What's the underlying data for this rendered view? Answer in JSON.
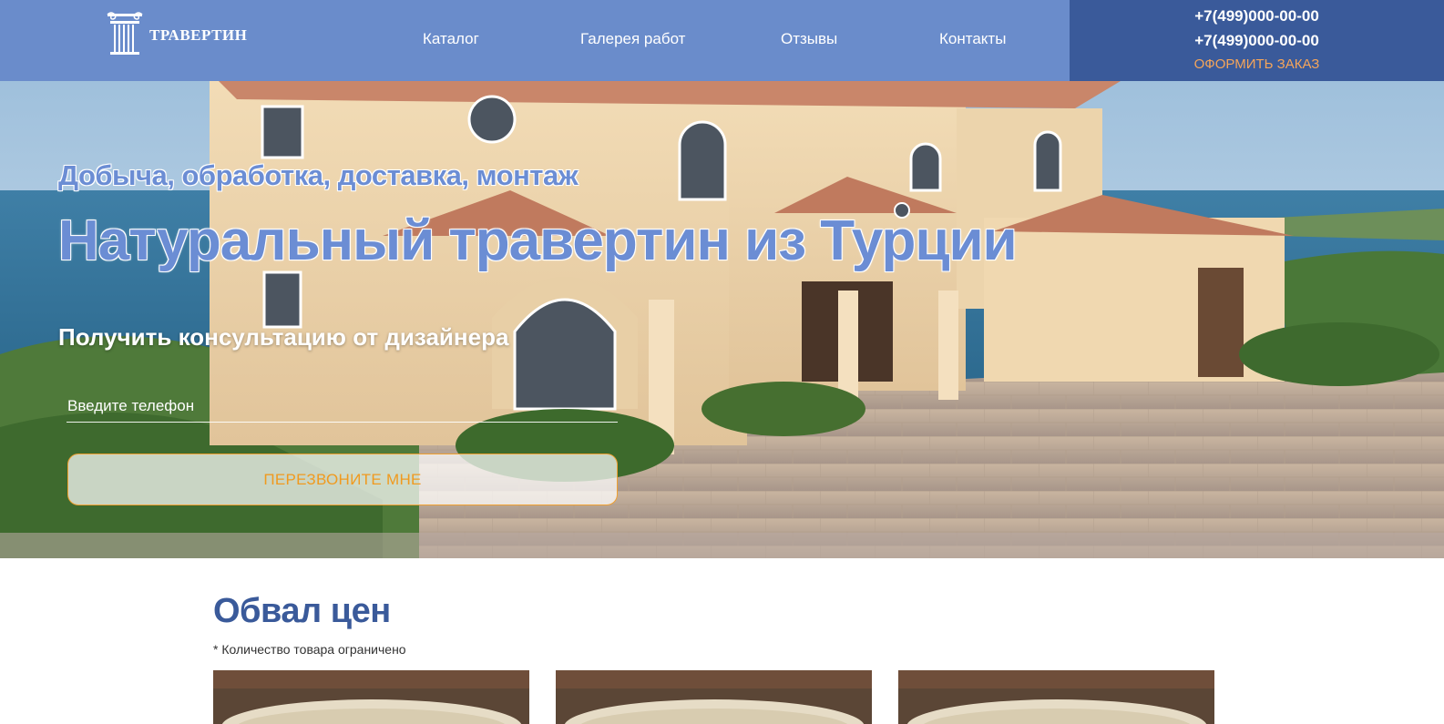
{
  "header": {
    "logo_text": "ТРАВЕРТИН",
    "nav": [
      "Каталог",
      "Галерея работ",
      "Отзывы",
      "Контакты"
    ],
    "phones": [
      "+7(499)000-00-00",
      "+7(499)000-00-00"
    ],
    "order_label": "ОФОРМИТЬ ЗАКАЗ"
  },
  "hero": {
    "subtitle": "Добыча, обработка, доставка, монтаж",
    "title": "Натуральный травертин из Турции",
    "consult": "Получить консультацию от дизайнера",
    "phone_placeholder": "Введите телефон",
    "button_label": "ПЕРЕЗВОНИТЕ МНЕ"
  },
  "prices": {
    "title": "Обвал цен",
    "note": "* Количество товара ограничено"
  },
  "colors": {
    "header_bg": "#6a8ccb",
    "contact_bg": "#3a5a9a",
    "accent_orange": "#f09a1f",
    "title_blue": "#6b8dd4"
  }
}
